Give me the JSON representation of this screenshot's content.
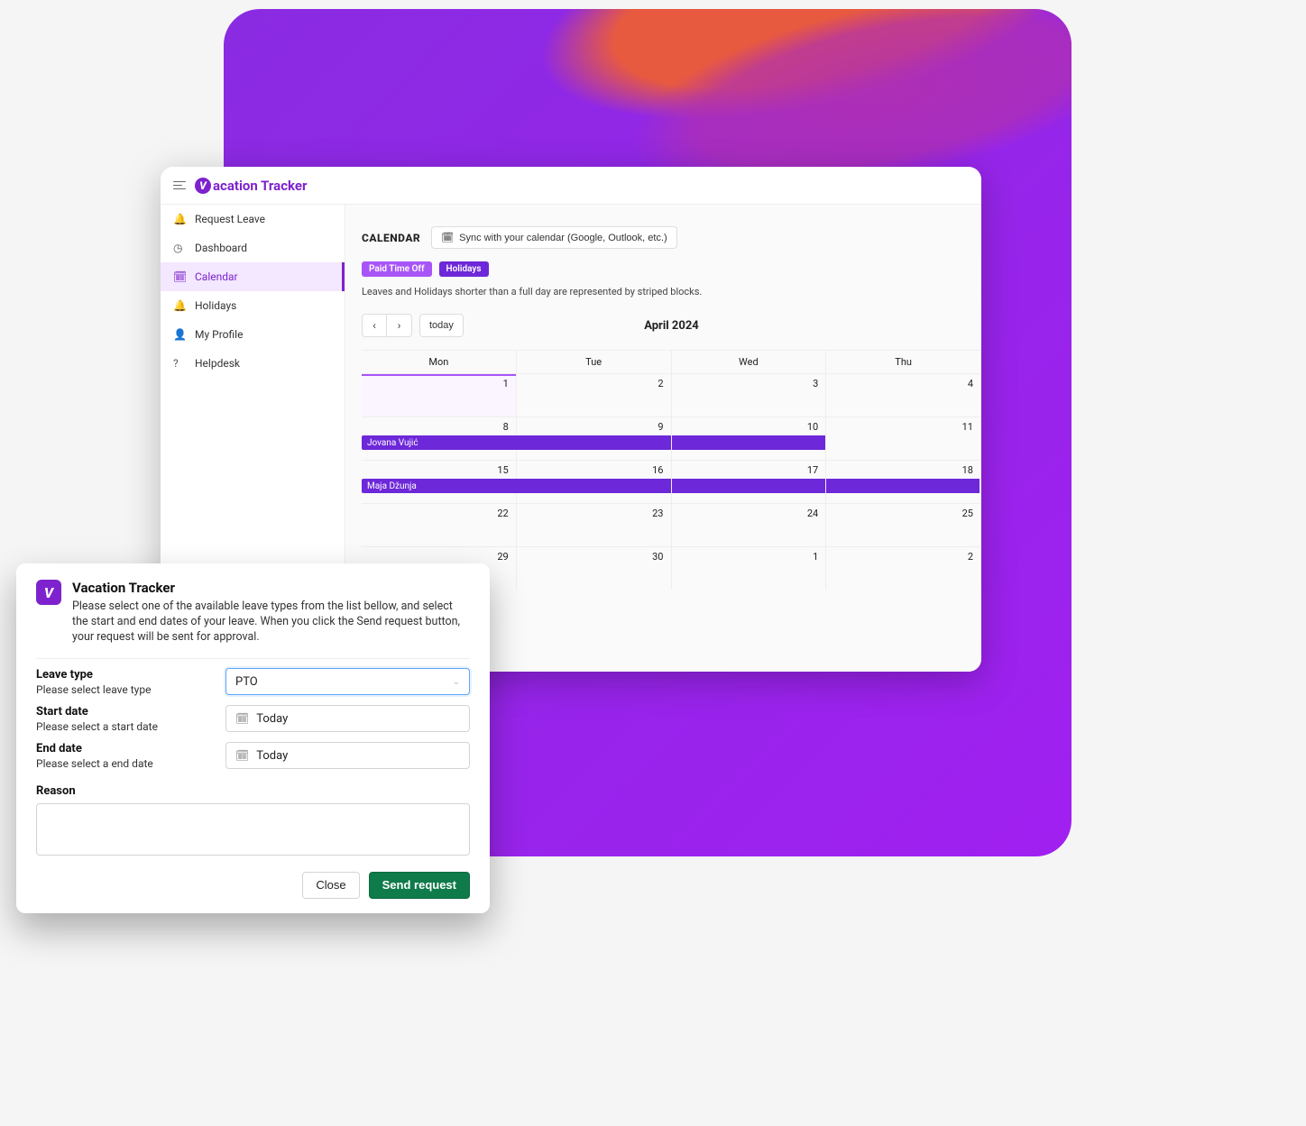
{
  "header": {
    "app_name": "acation Tracker"
  },
  "sidebar": {
    "items": [
      {
        "label": "Request Leave",
        "icon": "bell-icon"
      },
      {
        "label": "Dashboard",
        "icon": "dashboard-icon"
      },
      {
        "label": "Calendar",
        "icon": "calendar-icon",
        "active": true
      },
      {
        "label": "Holidays",
        "icon": "bell-icon"
      },
      {
        "label": "My Profile",
        "icon": "user-icon"
      },
      {
        "label": "Helpdesk",
        "icon": "help-icon"
      }
    ]
  },
  "main": {
    "section_title": "CALENDAR",
    "sync_button": "Sync with your calendar (Google, Outlook, etc.)",
    "chips": {
      "pto": "Paid Time Off",
      "holidays": "Holidays"
    },
    "note": "Leaves and Holidays shorter than a full day are represented by striped blocks.",
    "toolbar": {
      "today": "today",
      "month_label": "April 2024"
    },
    "days": [
      "Mon",
      "Tue",
      "Wed",
      "Thu"
    ],
    "rows": [
      [
        "1",
        "2",
        "3",
        "4"
      ],
      [
        "8",
        "9",
        "10",
        "11"
      ],
      [
        "15",
        "16",
        "17",
        "18"
      ],
      [
        "22",
        "23",
        "24",
        "25"
      ],
      [
        "29",
        "30",
        "1",
        "2"
      ]
    ],
    "events": {
      "row1": "Jovana Vujić",
      "row2": "Maja Džunja"
    }
  },
  "modal": {
    "title": "Vacation Tracker",
    "description": "Please select one of the available leave types from the list bellow, and select the start and end dates of your leave. When you click the Send request button, your request will be sent for approval.",
    "leave_type": {
      "label": "Leave type",
      "sub": "Please select leave type",
      "value": "PTO"
    },
    "start_date": {
      "label": "Start date",
      "sub": "Please select a start date",
      "value": "Today"
    },
    "end_date": {
      "label": "End date",
      "sub": "Please select a end date",
      "value": "Today"
    },
    "reason": {
      "label": "Reason",
      "value": ""
    },
    "buttons": {
      "close": "Close",
      "send": "Send request"
    }
  }
}
